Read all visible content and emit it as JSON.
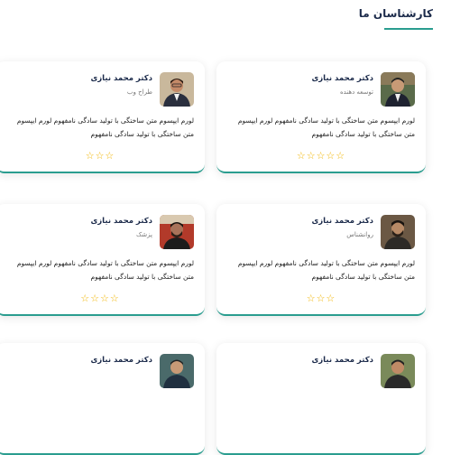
{
  "section": {
    "title": "کارشناسان ما"
  },
  "cards": [
    {
      "name": "دکتر محمد نیازی",
      "role": "توسعه دهنده",
      "desc": "لورم ایپسوم متن ساختگی با تولید سادگی نامفهوم لورم ایپسوم متن ساختگی با تولید سادگی نامفهوم",
      "stars": "☆☆☆☆☆",
      "avatar": "person-avatar-icon"
    },
    {
      "name": "دکتر محمد نیازی",
      "role": "طراح وب",
      "desc": "لورم ایپسوم متن ساختگی با تولید سادگی نامفهوم لورم ایپسوم متن ساختگی با تولید سادگی نامفهوم",
      "stars": "☆☆☆",
      "avatar": "person-avatar-icon"
    },
    {
      "name": "دکتر محمد نیازی",
      "role": "روانشناس",
      "desc": "لورم ایپسوم متن ساختگی با تولید سادگی نامفهوم لورم ایپسوم متن ساختگی با تولید سادگی نامفهوم",
      "stars": "☆☆☆",
      "avatar": "person-avatar-icon"
    },
    {
      "name": "دکتر محمد نیازی",
      "role": "پزشک",
      "desc": "لورم ایپسوم متن ساختگی با تولید سادگی نامفهوم لورم ایپسوم متن ساختگی با تولید سادگی نامفهوم",
      "stars": "☆☆☆☆",
      "avatar": "person-avatar-icon"
    },
    {
      "name": "دکتر محمد نیازی",
      "role": "",
      "desc": "",
      "stars": "",
      "avatar": "person-avatar-icon"
    },
    {
      "name": "دکتر محمد نیازی",
      "role": "",
      "desc": "",
      "stars": "",
      "avatar": "person-avatar-icon"
    }
  ],
  "colors": {
    "accent": "#2a9d8f",
    "star": "#f1b400",
    "name": "#1b2a4a"
  }
}
